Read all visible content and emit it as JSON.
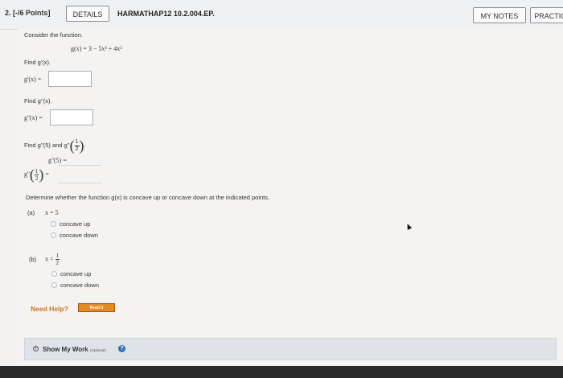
{
  "header": {
    "question_label": "2. [-/6 Points]",
    "details_button": "DETAILS",
    "problem_code": "HARMATHAP12 10.2.004.EP.",
    "my_notes_button": "MY NOTES",
    "practice_button": "PRACTIC"
  },
  "problem": {
    "intro": "Consider the function.",
    "function": "g(x) = 3 − 5x³ + 4x⁵",
    "find_first": "Find g'(x).",
    "first_label": "g'(x) =",
    "find_second": "Find g''(x).",
    "second_label": "g''(x) =",
    "find_values_prefix": "Find g''(5) and g''",
    "half_num": "1",
    "half_den": "2",
    "val5_label": "g''(5) =",
    "valhalf_prefix": "g''",
    "equals": "=",
    "concavity_prompt": "Determine whether the function g(x) is concave up or concave down at the indicated points.",
    "part_a_label": "(a)",
    "part_a_x": "x = 5",
    "part_b_label": "(b)",
    "part_b_x": "x =",
    "opt_up": "concave up",
    "opt_down": "concave down"
  },
  "help": {
    "need_help": "Need Help?",
    "read_it": "Read It"
  },
  "show_work": {
    "label": "Show My Work",
    "optional": "(Optional)"
  }
}
